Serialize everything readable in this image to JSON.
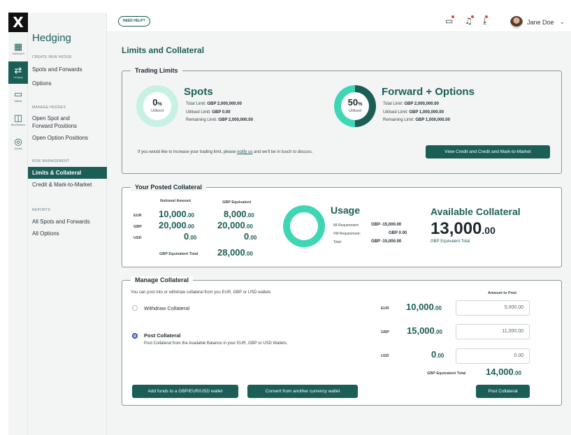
{
  "rail": {
    "logo": "X",
    "items": [
      {
        "label": "Dashboard",
        "icon": "grid-icon"
      },
      {
        "label": "Hedging",
        "icon": "arrows-icon"
      },
      {
        "label": "Wallets",
        "icon": "wallet-icon"
      },
      {
        "label": "Beneficiaries",
        "icon": "beneficiaries-icon"
      },
      {
        "label": "Quotes",
        "icon": "globe-icon"
      }
    ]
  },
  "nav": {
    "title": "Hedging",
    "create_section": "CREATE NEW HEDGE",
    "spots_forwards": "Spots and Forwards",
    "options": "Options",
    "manage_section": "MANAGE HEDGES",
    "open_spot_line1": "Open Spot and",
    "open_spot_line2": "Forward Positions",
    "open_option": "Open Option Positions",
    "risk_section": "RISK MANAGEMENT",
    "limits_collateral": "Limits & Collateral",
    "credit_mtm": "Credit & Mark-to-Market",
    "reports_section": "REPORTS",
    "all_spots": "All Spots and Forwards",
    "all_options": "All Options"
  },
  "topbar": {
    "help": "NEED HELP?",
    "user_name": "Jane Doe"
  },
  "page_title": "Limits and Collateral",
  "trading_limits": {
    "title": "Trading Limits",
    "spots": {
      "heading": "Spots",
      "utilised_value": "0",
      "utilised_pct_sign": "%",
      "utilised_label": "Utilised",
      "utilised_fraction": 0,
      "total_limit_label": "Total Limit:",
      "total_limit_value": "GBP 2,000,000.00",
      "utilised_limit_label": "Utilised Limit:",
      "utilised_limit_value": "GBP 0.00",
      "remaining_limit_label": "Remaining Limit:",
      "remaining_limit_value": "GBP 2,000,000.00"
    },
    "forward_options": {
      "heading": "Forward + Options",
      "utilised_value": "50",
      "utilised_pct_sign": "%",
      "utilised_label": "Utilised",
      "utilised_fraction": 0.5,
      "total_limit_label": "Total Limit:",
      "total_limit_value": "GBP 2,000,000.00",
      "utilised_limit_label": "Utilised Limit:",
      "utilised_limit_value": "GBP 1,000,000.00",
      "remaining_limit_label": "Remaining Limit:",
      "remaining_limit_value": "GBP 1,000,000.00"
    },
    "increase_text_before": "If you would like to increase your trading limit, please ",
    "increase_link": "notify us",
    "increase_text_after": " and we'll be in touch to discuss.",
    "view_credit_button": "View Credit and Credit and Mark-to-Market"
  },
  "posted_collateral": {
    "title": "Your Posted Collateral",
    "col_notional": "Notional Amount",
    "col_gbp_equiv": "GBP Equivalent",
    "rows": [
      {
        "ccy": "EUR",
        "notional": "10,000",
        "notional_dec": ".00",
        "gbp": "8,000",
        "gbp_dec": ".00"
      },
      {
        "ccy": "GBP",
        "notional": "20,000",
        "notional_dec": ".00",
        "gbp": "20,000",
        "gbp_dec": ".00"
      },
      {
        "ccy": "USD",
        "notional": "0",
        "notional_dec": ".00",
        "gbp": "0",
        "gbp_dec": ".00"
      }
    ],
    "total_label": "GBP Equivalent Total",
    "total_value": "28,000",
    "total_dec": ".00",
    "usage": {
      "heading": "Usage",
      "im_label": "IM Requirement:",
      "im_value": "GBP -15,000.00",
      "vm_label": "VM Requirement:",
      "vm_value": "GBP 0.00",
      "total_label": "Total:",
      "total_value": "GBP -15,000.00"
    },
    "available": {
      "heading": "Available Collateral",
      "value": "13,000",
      "dec": ".00",
      "sub": "GBP Equivalent Total"
    }
  },
  "manage_collateral": {
    "title": "Manage Collateral",
    "intro": "You can post into or withdraw collateral from you EUR, GBP or USD wallets",
    "amount_to_post": "Amount to Post",
    "withdraw_label": "Withdraw Collateral",
    "post_label": "Post Collateral",
    "post_desc": "Post Collateral from the Available Balance in your EUR, GBP or USD Wallets.",
    "selected": "post",
    "rows": [
      {
        "ccy": "EUR",
        "amount": "10,000",
        "dec": ".00",
        "input": "5,000.00"
      },
      {
        "ccy": "GBP",
        "amount": "15,000",
        "dec": ".00",
        "input": "11,000.00"
      },
      {
        "ccy": "USD",
        "amount": "0",
        "dec": ".00",
        "input": "0.00"
      }
    ],
    "total_label": "GBP Equivalent Total",
    "total_value": "14,000",
    "total_dec": ".00",
    "add_funds_button": "Add funds to a GBP/EUR/USD wallet",
    "convert_button": "Convert from another currency wallet",
    "post_button": "Post Collateral"
  },
  "colors": {
    "brand": "#1b5e56",
    "accent_teal": "#3fd6b4",
    "light_teal": "#c8f1e6"
  }
}
